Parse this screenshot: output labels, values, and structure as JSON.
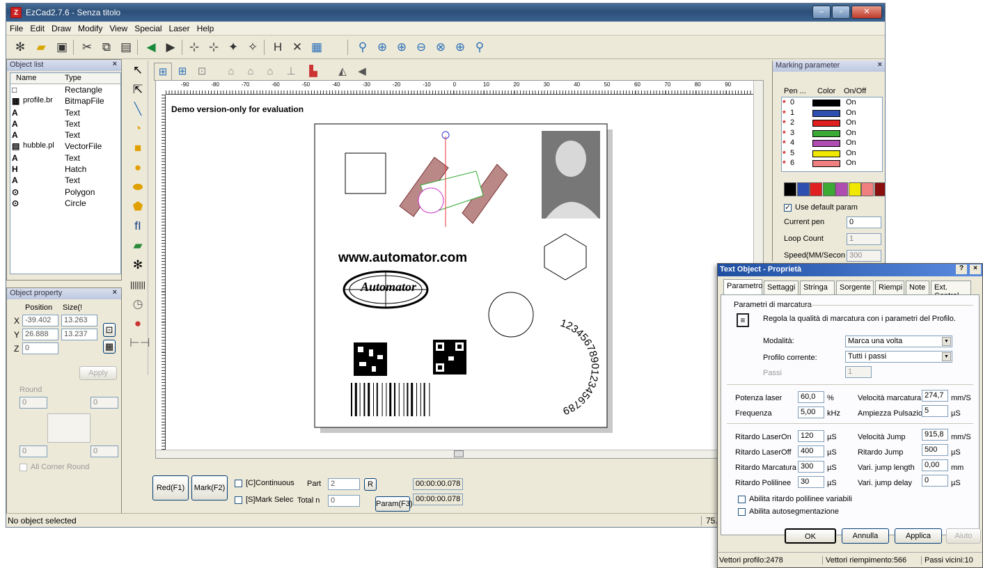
{
  "window": {
    "title": "EzCad2.7.6 - Senza titolo",
    "min": "–",
    "max": "▫",
    "close": "✕"
  },
  "menu": [
    "File",
    "Edit",
    "Draw",
    "Modify",
    "View",
    "Special",
    "Laser",
    "Help"
  ],
  "object_list": {
    "title": "Object list",
    "close": "×",
    "col_name": "Name",
    "col_type": "Type",
    "rows": [
      {
        "icon": "□",
        "name": "",
        "type": "Rectangle"
      },
      {
        "icon": "▦",
        "name": "profile.br",
        "type": "BitmapFile"
      },
      {
        "icon": "A",
        "name": "",
        "type": "Text"
      },
      {
        "icon": "A",
        "name": "",
        "type": "Text"
      },
      {
        "icon": "A",
        "name": "",
        "type": "Text"
      },
      {
        "icon": "▤",
        "name": "hubble.pl",
        "type": "VectorFile"
      },
      {
        "icon": "A",
        "name": "",
        "type": "Text"
      },
      {
        "icon": "H",
        "name": "",
        "type": "Hatch"
      },
      {
        "icon": "A",
        "name": "",
        "type": "Text"
      },
      {
        "icon": "⊙",
        "name": "",
        "type": "Polygon"
      },
      {
        "icon": "⊙",
        "name": "",
        "type": "Circle"
      }
    ]
  },
  "object_property": {
    "title": "Object property",
    "close": "×",
    "position_label": "Position",
    "size_label": "Size(!",
    "x_label": "X",
    "y_label": "Y",
    "z_label": "Z",
    "x_pos": "-39.402",
    "x_size": "13.263",
    "y_pos": "26.888",
    "y_size": "13.237",
    "z_pos": "0",
    "apply": "Apply",
    "round_label": "Round",
    "round_tl": "0",
    "round_tr": "0",
    "round_bl": "0",
    "round_br": "0",
    "all_corner": "All Corner Round"
  },
  "canvas": {
    "watermark": "Demo version-only for evaluation",
    "ruler_labels": [
      "-90",
      "-80",
      "-70",
      "-60",
      "-50",
      "-40",
      "-30",
      "-20",
      "-10",
      "0",
      "10",
      "20",
      "30",
      "40",
      "50",
      "60",
      "70",
      "80",
      "90"
    ],
    "url_text": "www.automator.com",
    "logo_text": "Automator",
    "arc_text": "1234567890123456789"
  },
  "bottom": {
    "red": "Red(F1)",
    "mark": "Mark(F2)",
    "continuous": "[C]Continuous",
    "mark_select": "[S]Mark Selec",
    "part_label": "Part",
    "part_value": "2",
    "total_label": "Total n",
    "total_value": "0",
    "r_button": "R",
    "param": "Param(F3)",
    "time1": "00:00:00.078",
    "time2": "00:00:00.078"
  },
  "status": {
    "text": "No object selected",
    "coord": "75.7"
  },
  "marking": {
    "title": "Marking parameter",
    "close": "×",
    "col_pen": "Pen ...",
    "col_color": "Color",
    "col_onoff": "On/Off",
    "pens": [
      {
        "pen": "0",
        "color": "#000000",
        "state": "On"
      },
      {
        "pen": "1",
        "color": "#2c4fb0",
        "state": "On"
      },
      {
        "pen": "2",
        "color": "#e02020",
        "state": "On"
      },
      {
        "pen": "3",
        "color": "#3aaa35",
        "state": "On"
      },
      {
        "pen": "4",
        "color": "#b04db0",
        "state": "On"
      },
      {
        "pen": "5",
        "color": "#f0e800",
        "state": "On"
      },
      {
        "pen": "6",
        "color": "#f07f7f",
        "state": "On"
      }
    ],
    "palette": [
      "#000000",
      "#2c4fb0",
      "#e02020",
      "#3aaa35",
      "#b04db0",
      "#f0e800",
      "#f07f7f",
      "#8a1010"
    ],
    "use_default": "Use default param",
    "current_pen_label": "Current pen",
    "current_pen": "0",
    "loop_label": "Loop Count",
    "loop_value": "1",
    "speed_label": "Speed(MM/Secon",
    "speed_value": "300"
  },
  "dialog": {
    "title": "Text Object - Proprietà",
    "help": "?",
    "close": "×",
    "tabs": [
      "Parametro",
      "Settaggi",
      "Stringa",
      "Sorgente",
      "Riempi",
      "Note",
      "Ext. Control"
    ],
    "group_title": "Parametri di marcatura",
    "info": "Regola la qualità di marcatura con i parametri del Profilo.",
    "modalita_label": "Modalità:",
    "modalita_value": "Marca una volta",
    "profilo_label": "Profilo corrente:",
    "profilo_value": "Tutti i passi",
    "passi_label": "Passi",
    "passi_value": "1",
    "potenza_label": "Potenza laser",
    "potenza_value": "60,0",
    "potenza_unit": "%",
    "frequenza_label": "Frequenza",
    "frequenza_value": "5,00",
    "frequenza_unit": "kHz",
    "vel_marc_label": "Velocità marcatura",
    "vel_marc_value": "274,7",
    "vel_marc_unit": "mm/S",
    "ampiezza_label": "Ampiezza Pulsazione",
    "ampiezza_value": "5",
    "ampiezza_unit": "µS",
    "laseron_label": "Ritardo LaserOn",
    "laseron_value": "120",
    "laseroff_label": "Ritardo LaserOff",
    "laseroff_value": "400",
    "marcatura_label": "Ritardo Marcatura",
    "marcatura_value": "300",
    "polilinee_label": "Ritardo Polilinee",
    "polilinee_value": "30",
    "us": "µS",
    "vel_jump_label": "Velocità Jump",
    "vel_jump_value": "915,8",
    "vel_jump_unit": "mm/S",
    "rit_jump_label": "Ritardo Jump",
    "rit_jump_value": "500",
    "jump_len_label": "Vari. jump length",
    "jump_len_value": "0,00",
    "jump_len_unit": "mm",
    "jump_delay_label": "Vari. jump delay",
    "jump_delay_value": "0",
    "chk1": "Abilita ritardo polilinee variabili",
    "chk2": "Abilita autosegmentazione",
    "ok": "OK",
    "annulla": "Annulla",
    "applica": "Applica",
    "aiuto": "Aiuto",
    "stat1": "Vettori profilo:2478",
    "stat2": "Vettori riempimento:566",
    "stat3": "Passi  vicini:10"
  }
}
